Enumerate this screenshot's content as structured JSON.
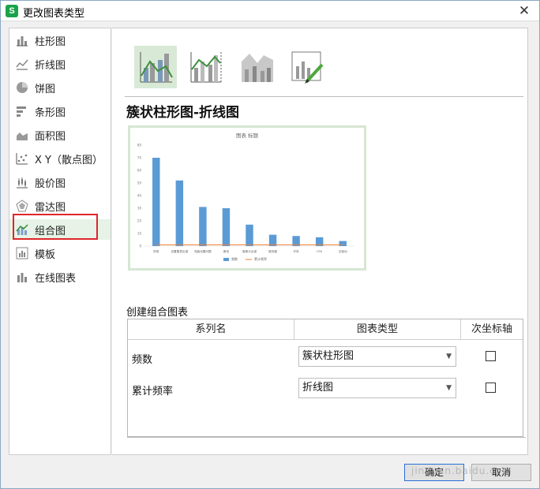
{
  "window": {
    "title": "更改图表类型",
    "app_icon": "S"
  },
  "sidebar": {
    "items": [
      {
        "label": "柱形图",
        "icon": "column-chart-icon"
      },
      {
        "label": "折线图",
        "icon": "line-chart-icon"
      },
      {
        "label": "饼图",
        "icon": "pie-chart-icon"
      },
      {
        "label": "条形图",
        "icon": "bar-chart-icon"
      },
      {
        "label": "面积图",
        "icon": "area-chart-icon"
      },
      {
        "label": "X Y（散点图）",
        "icon": "scatter-chart-icon"
      },
      {
        "label": "股价图",
        "icon": "stock-chart-icon"
      },
      {
        "label": "雷达图",
        "icon": "radar-chart-icon"
      },
      {
        "label": "组合图",
        "icon": "combo-chart-icon"
      },
      {
        "label": "模板",
        "icon": "template-icon"
      },
      {
        "label": "在线图表",
        "icon": "online-chart-icon"
      }
    ],
    "selected": "组合图"
  },
  "main": {
    "subtypes": [
      "clustered-column-line-icon",
      "clustered-column-line-secondary-icon",
      "stacked-area-column-icon",
      "custom-combo-icon"
    ],
    "selected_subtype": "clustered-column-line-icon",
    "heading": "簇状柱形图-折线图",
    "combo_label": "创建组合图表",
    "table": {
      "headers": [
        "系列名",
        "图表类型",
        "次坐标轴"
      ],
      "rows": [
        {
          "name": "频数",
          "chart_type": "簇状柱形图",
          "secondary": false
        },
        {
          "name": "累计频率",
          "chart_type": "折线图",
          "secondary": false
        }
      ]
    }
  },
  "chart_data": {
    "type": "bar",
    "title": "图表 标题",
    "categories": [
      "异常",
      "设置图表出错",
      "电脑设置问题",
      "断电",
      "摄像头出错",
      "服务器",
      "开机",
      "CPU",
      "无驱动"
    ],
    "series": [
      {
        "name": "频数",
        "type": "bar",
        "values": [
          70,
          52,
          31,
          30,
          17,
          9,
          8,
          7,
          4
        ]
      },
      {
        "name": "累计频率",
        "type": "line",
        "values": [
          1,
          1,
          1,
          1,
          1,
          1,
          1,
          1,
          1
        ]
      }
    ],
    "y_ticks": [
      "0",
      "10",
      "20",
      "30",
      "40",
      "50",
      "60",
      "70",
      "80"
    ],
    "ylim": [
      0,
      80
    ],
    "colors": {
      "bar": "#5b9bd5",
      "line": "#ed7d31"
    },
    "legend": "bottom"
  },
  "buttons": {
    "ok": "确定",
    "cancel": "取消"
  },
  "watermark": "jingyan.baidu.com"
}
